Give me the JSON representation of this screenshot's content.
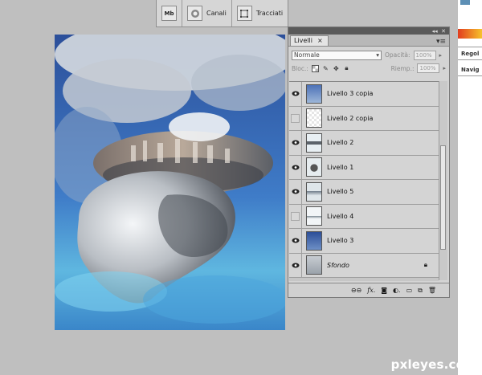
{
  "top_dock": {
    "items": [
      {
        "icon": "mini-bridge-icon",
        "icon_text": "Mb",
        "label": ""
      },
      {
        "icon": "channels-icon",
        "label": "Canali"
      },
      {
        "icon": "paths-icon",
        "label": "Tracciati"
      }
    ]
  },
  "layers_panel": {
    "tab_label": "Livelli",
    "blend_mode": "Normale",
    "opacity_label": "Opacità:",
    "opacity_value": "100%",
    "lock_label": "Bloc.:",
    "fill_label": "Riemp.:",
    "fill_value": "100%",
    "layers": [
      {
        "name": "Livello 3 copia",
        "visible": true,
        "locked": false,
        "italic": false
      },
      {
        "name": "Livello 2 copia",
        "visible": false,
        "locked": false,
        "italic": false
      },
      {
        "name": "Livello 2",
        "visible": true,
        "locked": false,
        "italic": false
      },
      {
        "name": "Livello 1",
        "visible": true,
        "locked": false,
        "italic": false
      },
      {
        "name": "Livello 5",
        "visible": true,
        "locked": false,
        "italic": false
      },
      {
        "name": "Livello 4",
        "visible": false,
        "locked": false,
        "italic": false
      },
      {
        "name": "Livello 3",
        "visible": true,
        "locked": false,
        "italic": false
      },
      {
        "name": "Sfondo",
        "visible": true,
        "locked": true,
        "italic": true
      }
    ],
    "footer_icons": [
      "link-layers-icon",
      "fx-icon",
      "layer-mask-icon",
      "adjustment-layer-icon",
      "group-icon",
      "new-layer-icon",
      "trash-icon"
    ]
  },
  "right_dock": {
    "items": [
      "Regol",
      "Navig"
    ]
  },
  "watermark": "pxleyes.com",
  "colors": {
    "workspace_bg": "#bfbfbf",
    "panel_bg": "#d4d4d4",
    "sky_blue": "#2d58a8"
  }
}
